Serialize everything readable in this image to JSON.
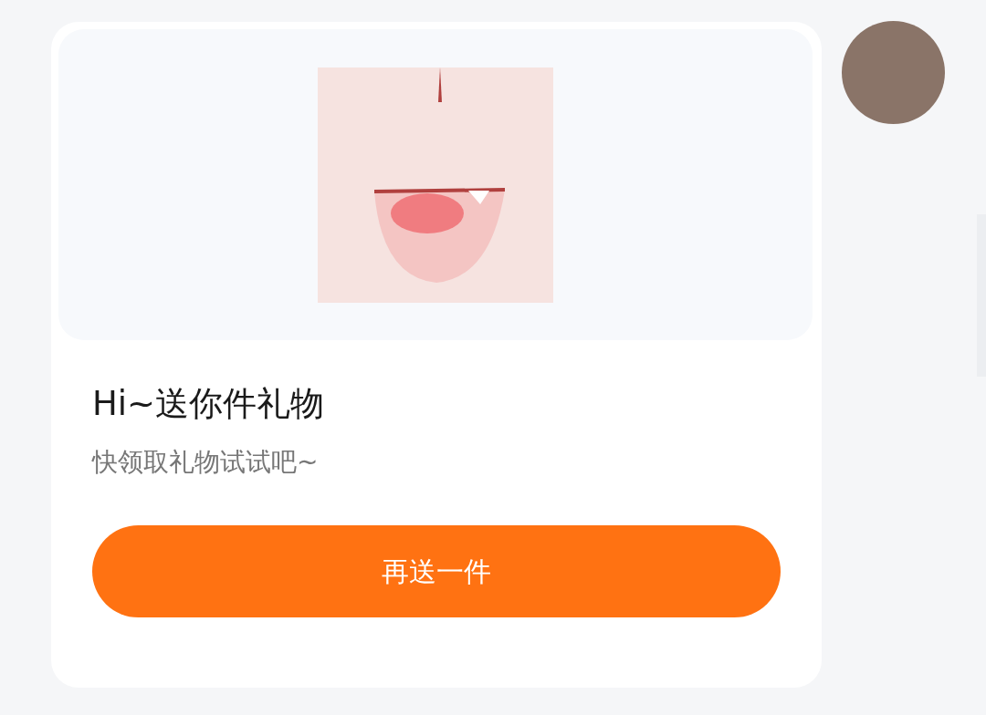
{
  "message": {
    "title": "Hi~送你件礼物",
    "subtitle": "快领取礼物试试吧~",
    "button": "再送一件"
  }
}
